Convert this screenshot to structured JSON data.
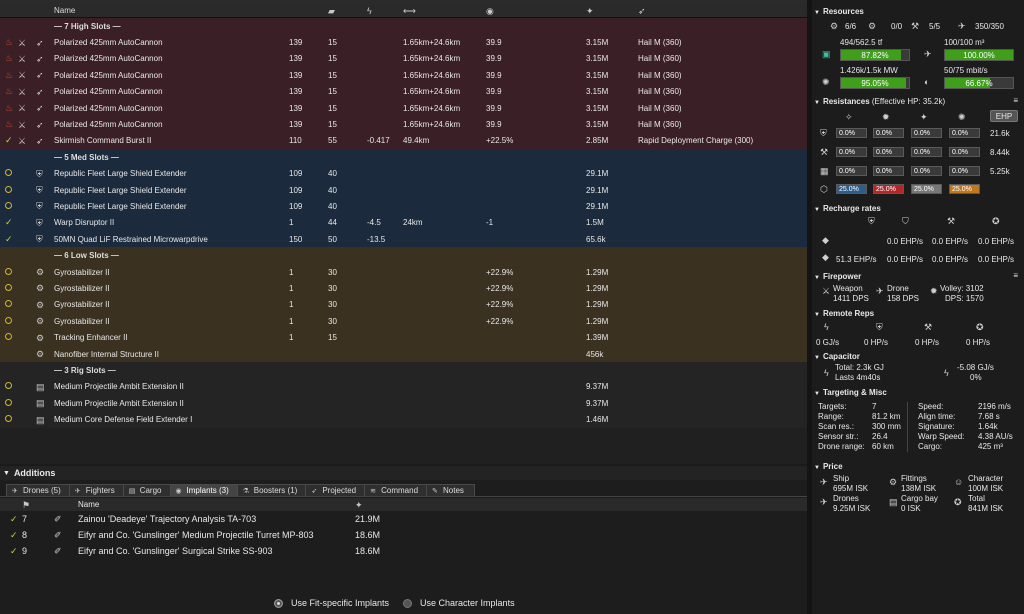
{
  "window": {
    "title_strip": ""
  },
  "fitting": {
    "columns": {
      "name": "Name"
    },
    "sections": {
      "high": "— 7 High Slots —",
      "med": "— 5 Med Slots —",
      "low": "— 6 Low Slots —",
      "rig": "— 3 Rig Slots —"
    },
    "high": [
      {
        "name": "Polarized 425mm AutoCannon",
        "cpu": "139",
        "pg": "15",
        "cap": "",
        "range": "1.65km+24.6km",
        "dps": "39.9",
        "price": "3.15M",
        "charge": "Hail M (360)",
        "state": "heat"
      },
      {
        "name": "Polarized 425mm AutoCannon",
        "cpu": "139",
        "pg": "15",
        "cap": "",
        "range": "1.65km+24.6km",
        "dps": "39.9",
        "price": "3.15M",
        "charge": "Hail M (360)",
        "state": "heat"
      },
      {
        "name": "Polarized 425mm AutoCannon",
        "cpu": "139",
        "pg": "15",
        "cap": "",
        "range": "1.65km+24.6km",
        "dps": "39.9",
        "price": "3.15M",
        "charge": "Hail M (360)",
        "state": "heat"
      },
      {
        "name": "Polarized 425mm AutoCannon",
        "cpu": "139",
        "pg": "15",
        "cap": "",
        "range": "1.65km+24.6km",
        "dps": "39.9",
        "price": "3.15M",
        "charge": "Hail M (360)",
        "state": "heat"
      },
      {
        "name": "Polarized 425mm AutoCannon",
        "cpu": "139",
        "pg": "15",
        "cap": "",
        "range": "1.65km+24.6km",
        "dps": "39.9",
        "price": "3.15M",
        "charge": "Hail M (360)",
        "state": "heat"
      },
      {
        "name": "Polarized 425mm AutoCannon",
        "cpu": "139",
        "pg": "15",
        "cap": "",
        "range": "1.65km+24.6km",
        "dps": "39.9",
        "price": "3.15M",
        "charge": "Hail M (360)",
        "state": "heat"
      },
      {
        "name": "Skirmish Command Burst II",
        "cpu": "110",
        "pg": "55",
        "cap": "-0.417",
        "range": "49.4km",
        "dps": "+22.5%",
        "price": "2.85M",
        "charge": "Rapid Deployment Charge (300)",
        "state": "check"
      }
    ],
    "med": [
      {
        "name": "Republic Fleet Large Shield Extender",
        "cpu": "109",
        "pg": "40",
        "cap": "",
        "range": "",
        "dps": "",
        "price": "29.1M",
        "charge": "",
        "state": "ring"
      },
      {
        "name": "Republic Fleet Large Shield Extender",
        "cpu": "109",
        "pg": "40",
        "cap": "",
        "range": "",
        "dps": "",
        "price": "29.1M",
        "charge": "",
        "state": "ring"
      },
      {
        "name": "Republic Fleet Large Shield Extender",
        "cpu": "109",
        "pg": "40",
        "cap": "",
        "range": "",
        "dps": "",
        "price": "29.1M",
        "charge": "",
        "state": "ring"
      },
      {
        "name": "Warp Disruptor II",
        "cpu": "1",
        "pg": "44",
        "cap": "-4.5",
        "range": "24km",
        "dps": "-1",
        "price": "1.5M",
        "charge": "",
        "state": "check"
      },
      {
        "name": "50MN Quad LiF Restrained Microwarpdrive",
        "cpu": "150",
        "pg": "50",
        "cap": "-13.5",
        "range": "",
        "dps": "",
        "price": "65.6k",
        "charge": "",
        "state": "check"
      }
    ],
    "low": [
      {
        "name": "Gyrostabilizer II",
        "cpu": "1",
        "pg": "30",
        "cap": "",
        "range": "",
        "dps": "+22.9%",
        "price": "1.29M",
        "charge": "",
        "state": "ring"
      },
      {
        "name": "Gyrostabilizer II",
        "cpu": "1",
        "pg": "30",
        "cap": "",
        "range": "",
        "dps": "+22.9%",
        "price": "1.29M",
        "charge": "",
        "state": "ring"
      },
      {
        "name": "Gyrostabilizer II",
        "cpu": "1",
        "pg": "30",
        "cap": "",
        "range": "",
        "dps": "+22.9%",
        "price": "1.29M",
        "charge": "",
        "state": "ring"
      },
      {
        "name": "Gyrostabilizer II",
        "cpu": "1",
        "pg": "30",
        "cap": "",
        "range": "",
        "dps": "+22.9%",
        "price": "1.29M",
        "charge": "",
        "state": "ring"
      },
      {
        "name": "Tracking Enhancer II",
        "cpu": "1",
        "pg": "15",
        "cap": "",
        "range": "",
        "dps": "",
        "price": "1.39M",
        "charge": "",
        "state": "ring"
      },
      {
        "name": "Nanofiber Internal Structure II",
        "cpu": "",
        "pg": "",
        "cap": "",
        "range": "",
        "dps": "",
        "price": "456k",
        "charge": "",
        "state": "none"
      }
    ],
    "rig": [
      {
        "name": "Medium Projectile Ambit Extension II",
        "price": "9.37M",
        "state": "ring"
      },
      {
        "name": "Medium Projectile Ambit Extension II",
        "price": "9.37M",
        "state": "ring"
      },
      {
        "name": "Medium Core Defense Field Extender I",
        "price": "1.46M",
        "state": "ring"
      }
    ]
  },
  "additions": {
    "title": "Additions",
    "tabs": [
      {
        "label": "Drones (5)",
        "icon": "drone-icon"
      },
      {
        "label": "Fighters",
        "icon": "fighter-icon"
      },
      {
        "label": "Cargo",
        "icon": "cargo-icon"
      },
      {
        "label": "Implants (3)",
        "icon": "implant-icon"
      },
      {
        "label": "Boosters (1)",
        "icon": "booster-icon"
      },
      {
        "label": "Projected",
        "icon": "projected-icon"
      },
      {
        "label": "Command",
        "icon": "command-icon"
      },
      {
        "label": "Notes",
        "icon": "notes-icon"
      }
    ],
    "active_tab": 3,
    "columns": {
      "name": "Name"
    },
    "implants": [
      {
        "slot": "7",
        "name": "Zainou 'Deadeye' Trajectory Analysis TA-703",
        "price": "21.9M"
      },
      {
        "slot": "8",
        "name": "Eifyr and Co. 'Gunslinger' Medium Projectile Turret MP-803",
        "price": "18.6M"
      },
      {
        "slot": "9",
        "name": "Eifyr and Co. 'Gunslinger' Surgical Strike SS-903",
        "price": "18.6M"
      }
    ],
    "radio_fit": "Use Fit-specific Implants",
    "radio_char": "Use Character Implants"
  },
  "stats": {
    "resources": {
      "title": "Resources",
      "turrets": "6/6",
      "launchers": "0/0",
      "calibration": "5/5",
      "drone_bay": "350/350",
      "cpu_text": "494/562.5 tf",
      "cpu_pct": "87.82%",
      "cpu_fraction": 0.8782,
      "drone_vol": "100/100 m³",
      "drone_vol_pct": "100.00%",
      "drone_vol_fraction": 1.0,
      "pg_text": "1.426k/1.5k MW",
      "pg_pct": "95.05%",
      "pg_fraction": 0.9505,
      "bandwidth": "50/75 mbit/s",
      "bw_pct": "66.67%",
      "bw_fraction": 0.6667
    },
    "resistances": {
      "title": "Resistances",
      "ehp_label": "(Effective HP: 35.2k)",
      "ehp_button": "EHP",
      "rows": [
        {
          "values": [
            "0.0%",
            "0.0%",
            "0.0%",
            "0.0%"
          ],
          "hp": "21.6k"
        },
        {
          "values": [
            "0.0%",
            "0.0%",
            "0.0%",
            "0.0%"
          ],
          "hp": "8.44k"
        },
        {
          "values": [
            "0.0%",
            "0.0%",
            "0.0%",
            "0.0%"
          ],
          "hp": "5.25k"
        },
        {
          "values": [
            "25.0%",
            "25.0%",
            "25.0%",
            "25.0%"
          ],
          "hp": ""
        }
      ]
    },
    "recharge": {
      "title": "Recharge rates",
      "row1": [
        "0.0 EHP/s",
        "0.0 EHP/s",
        "0.0 EHP/s"
      ],
      "row2": [
        "51.3 EHP/s",
        "0.0 EHP/s",
        "0.0 EHP/s",
        "0.0 EHP/s"
      ]
    },
    "firepower": {
      "title": "Firepower",
      "weapon_label": "Weapon",
      "weapon_dps": "1411 DPS",
      "drone_label": "Drone",
      "drone_dps": "158 DPS",
      "volley": "Volley: 3102",
      "dps": "DPS: 1570"
    },
    "remote": {
      "title": "Remote Reps",
      "values": [
        "0 GJ/s",
        "0 HP/s",
        "0 HP/s",
        "0 HP/s"
      ]
    },
    "capacitor": {
      "title": "Capacitor",
      "total": "Total: 2.3k GJ",
      "lasts": "Lasts 4m40s",
      "delta": "-5.08 GJ/s",
      "pct": "0%"
    },
    "targeting": {
      "title": "Targeting & Misc",
      "left": [
        [
          "Targets:",
          "7"
        ],
        [
          "Range:",
          "81.2 km"
        ],
        [
          "Scan res.:",
          "300 mm"
        ],
        [
          "Sensor str.:",
          "26.4"
        ],
        [
          "Drone range:",
          "60 km"
        ]
      ],
      "right": [
        [
          "Speed:",
          "2196 m/s"
        ],
        [
          "Align time:",
          "7.68 s"
        ],
        [
          "Signature:",
          "1.64k"
        ],
        [
          "Warp Speed:",
          "4.38 AU/s"
        ],
        [
          "Cargo:",
          "425 m³"
        ]
      ]
    },
    "price": {
      "title": "Price",
      "ship_label": "Ship",
      "ship": "695M ISK",
      "fittings_label": "Fittings",
      "fittings": "138M ISK",
      "character_label": "Character",
      "character": "100M ISK",
      "drones_label": "Drones",
      "drones": "9.25M ISK",
      "cargo_label": "Cargo bay",
      "cargo": "0 ISK",
      "total_label": "Total",
      "total": "841M ISK"
    }
  },
  "colors": {
    "high_bg": "#3b1f26",
    "med_bg": "#1b2a3d",
    "low_bg": "#3a3120",
    "bar_fill": "#3f9e1a",
    "res_em": "#2e5d8a",
    "res_therm": "#b0282a",
    "res_kin": "#777777",
    "res_exp": "#c07820"
  }
}
